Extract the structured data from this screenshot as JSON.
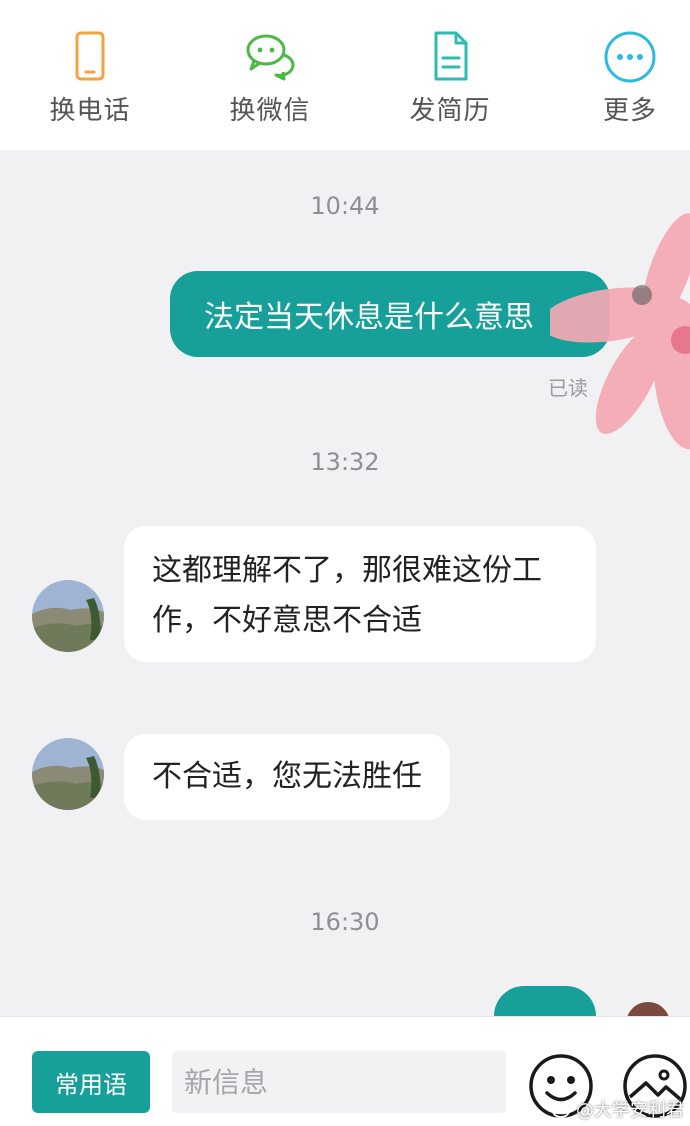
{
  "actions": [
    {
      "label": "换电话",
      "icon": "phone-icon",
      "color": "#f5a23d"
    },
    {
      "label": "换微信",
      "icon": "wechat-icon",
      "color": "#4cb848"
    },
    {
      "label": "发简历",
      "icon": "resume-icon",
      "color": "#2ebcb0"
    },
    {
      "label": "更多",
      "icon": "more-icon",
      "color": "#2eb9e0"
    }
  ],
  "messages": {
    "time1": "10:44",
    "out1": "法定当天休息是什么意思",
    "out1_status": "已读",
    "time2": "13:32",
    "in1": "这都理解不了，那很难这份工作，不好意思不合适",
    "in2": "不合适，您无法胜任",
    "time3": "16:30"
  },
  "input": {
    "quick_reply": "常用语",
    "placeholder": "新信息",
    "emoji_icon": "smiley-icon",
    "image_icon": "image-icon"
  },
  "watermark": {
    "text": "@大学安利君"
  },
  "colors": {
    "accent": "#17a09a",
    "background": "#f1f1f4",
    "sticker": "#f4a9b3"
  }
}
